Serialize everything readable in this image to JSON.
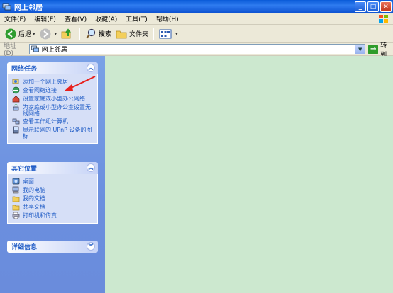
{
  "window": {
    "title": "网上邻居"
  },
  "menu": {
    "items": [
      "文件(F)",
      "编辑(E)",
      "查看(V)",
      "收藏(A)",
      "工具(T)",
      "帮助(H)"
    ]
  },
  "toolbar": {
    "back_label": "后退",
    "search_label": "搜索",
    "folders_label": "文件夹"
  },
  "address": {
    "label": "地址(D)",
    "value": "网上邻居",
    "go_label": "转到"
  },
  "panels": {
    "network_tasks": {
      "title": "网络任务",
      "items": [
        "添加一个网上邻居",
        "查看网络连接",
        "设置家庭或小型办公网络",
        "为家庭或小型办公室设置无线网络",
        "查看工作组计算机",
        "显示联网的 UPnP 设备的图标"
      ]
    },
    "other_places": {
      "title": "其它位置",
      "items": [
        "桌面",
        "我的电脑",
        "我的文档",
        "共享文档",
        "打印机和传真"
      ]
    },
    "details": {
      "title": "详细信息"
    }
  },
  "colors": {
    "title_bar": "#0a5bd8",
    "left_pane": "#7aa1e6",
    "content_bg": "#cce8cf",
    "link": "#215dc6",
    "annotation_arrow": "#e8201c"
  }
}
